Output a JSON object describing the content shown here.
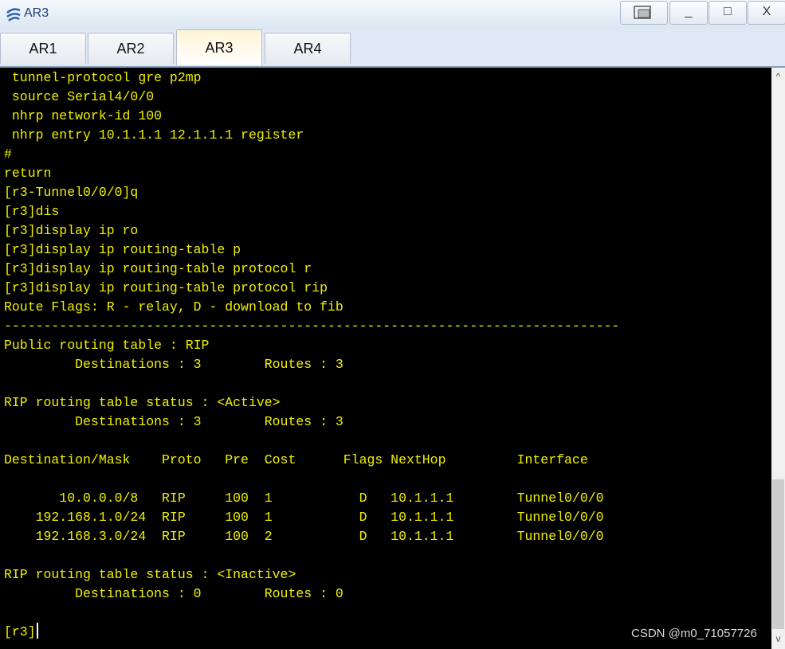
{
  "window": {
    "title": "AR3"
  },
  "controls": {
    "minimize": "_",
    "maximize": "□",
    "close": "X"
  },
  "tabs": [
    {
      "label": "AR1"
    },
    {
      "label": "AR2"
    },
    {
      "label": "AR3",
      "active": true
    },
    {
      "label": "AR4"
    }
  ],
  "terminal": {
    "text_color": "#f0f000",
    "lines": [
      " tunnel-protocol gre p2mp",
      " source Serial4/0/0",
      " nhrp network-id 100",
      " nhrp entry 10.1.1.1 12.1.1.1 register",
      "#",
      "return",
      "[r3-Tunnel0/0/0]q",
      "[r3]dis",
      "[r3]display ip ro",
      "[r3]display ip routing-table p",
      "[r3]display ip routing-table protocol r",
      "[r3]display ip routing-table protocol rip",
      "Route Flags: R - relay, D - download to fib",
      "------------------------------------------------------------------------------",
      "Public routing table : RIP",
      "         Destinations : 3        Routes : 3",
      "",
      "RIP routing table status : <Active>",
      "         Destinations : 3        Routes : 3",
      "",
      "Destination/Mask    Proto   Pre  Cost      Flags NextHop         Interface",
      "",
      "       10.0.0.0/8   RIP     100  1           D   10.1.1.1        Tunnel0/0/0",
      "    192.168.1.0/24  RIP     100  1           D   10.1.1.1        Tunnel0/0/0",
      "    192.168.3.0/24  RIP     100  2           D   10.1.1.1        Tunnel0/0/0",
      "",
      "RIP routing table status : <Inactive>",
      "         Destinations : 0        Routes : 0",
      "",
      "[r3]"
    ]
  },
  "scrollbar": {
    "up": "^",
    "down": "v"
  },
  "watermark": "CSDN @m0_71057726"
}
